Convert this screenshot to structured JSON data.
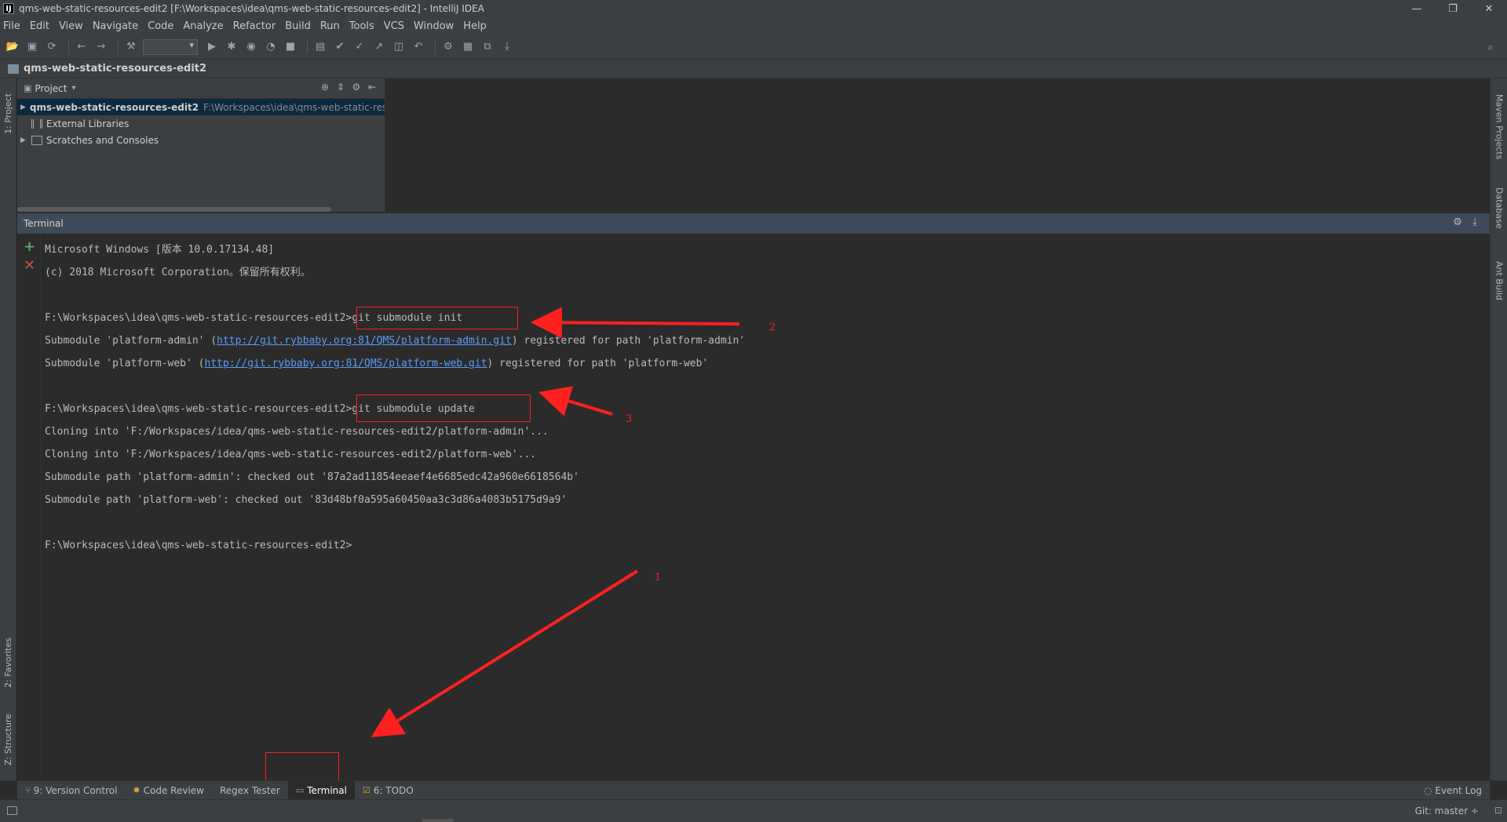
{
  "window": {
    "title": "qms-web-static-resources-edit2 [F:\\Workspaces\\idea\\qms-web-static-resources-edit2] - IntelliJ IDEA",
    "app_icon": "IJ",
    "controls": [
      "—",
      "❐",
      "✕"
    ]
  },
  "menu": [
    "File",
    "Edit",
    "View",
    "Navigate",
    "Code",
    "Analyze",
    "Refactor",
    "Build",
    "Run",
    "Tools",
    "VCS",
    "Window",
    "Help"
  ],
  "navbar": {
    "crumb": "qms-web-static-resources-edit2"
  },
  "left_stripe": {
    "project": "1: Project",
    "favorites": "2: Favorites",
    "structure": "Z: Structure"
  },
  "right_stripe": {
    "maven": "Maven Projects",
    "database": "Database",
    "ant": "Ant Build"
  },
  "project_panel": {
    "header": "Project",
    "tree": [
      {
        "label": "qms-web-static-resources-edit2",
        "path": "F:\\Workspaces\\idea\\qms-web-static-res"
      },
      {
        "label": "External Libraries"
      },
      {
        "label": "Scratches and Consoles"
      }
    ]
  },
  "terminal": {
    "title": "Terminal",
    "lines": {
      "l1": "Microsoft Windows [版本 10.0.17134.48]",
      "l2": "(c) 2018 Microsoft Corporation。保留所有权利。",
      "prompt": "F:\\Workspaces\\idea\\qms-web-static-resources-edit2>",
      "cmd_init": "git submodule init",
      "admin_pre": "Submodule 'platform-admin' (",
      "admin_url": "http://git.rybbaby.org:81/QMS/platform-admin.git",
      "admin_post": ") registered for path 'platform-admin'",
      "web_pre": "Submodule 'platform-web' (",
      "web_url": "http://git.rybbaby.org:81/QMS/platform-web.git",
      "web_post": ") registered for path 'platform-web'",
      "cmd_update": "git submodule update",
      "clone_admin": "Cloning into 'F:/Workspaces/idea/qms-web-static-resources-edit2/platform-admin'...",
      "clone_web": "Cloning into 'F:/Workspaces/idea/qms-web-static-resources-edit2/platform-web'...",
      "path_admin": "Submodule path 'platform-admin': checked out '87a2ad11854eeaef4e6685edc42a960e6618564b'",
      "path_web": "Submodule path 'platform-web': checked out '83d48bf0a595a60450aa3c3d86a4083b5175d9a9'"
    }
  },
  "annotations": {
    "n1": "1",
    "n2": "2",
    "n3": "3",
    "color": "#ff2020"
  },
  "bottom_tabs": {
    "version_control": "9: Version Control",
    "code_review": "Code Review",
    "regex": "Regex Tester",
    "terminal": "Terminal",
    "todo": "6: TODO",
    "event_log": "Event Log"
  },
  "status": {
    "git": "Git: master ÷"
  },
  "colors": {
    "background": "#2b2b2b",
    "panel": "#3c3f41",
    "link": "#589df6",
    "selection": "#0d293e"
  }
}
